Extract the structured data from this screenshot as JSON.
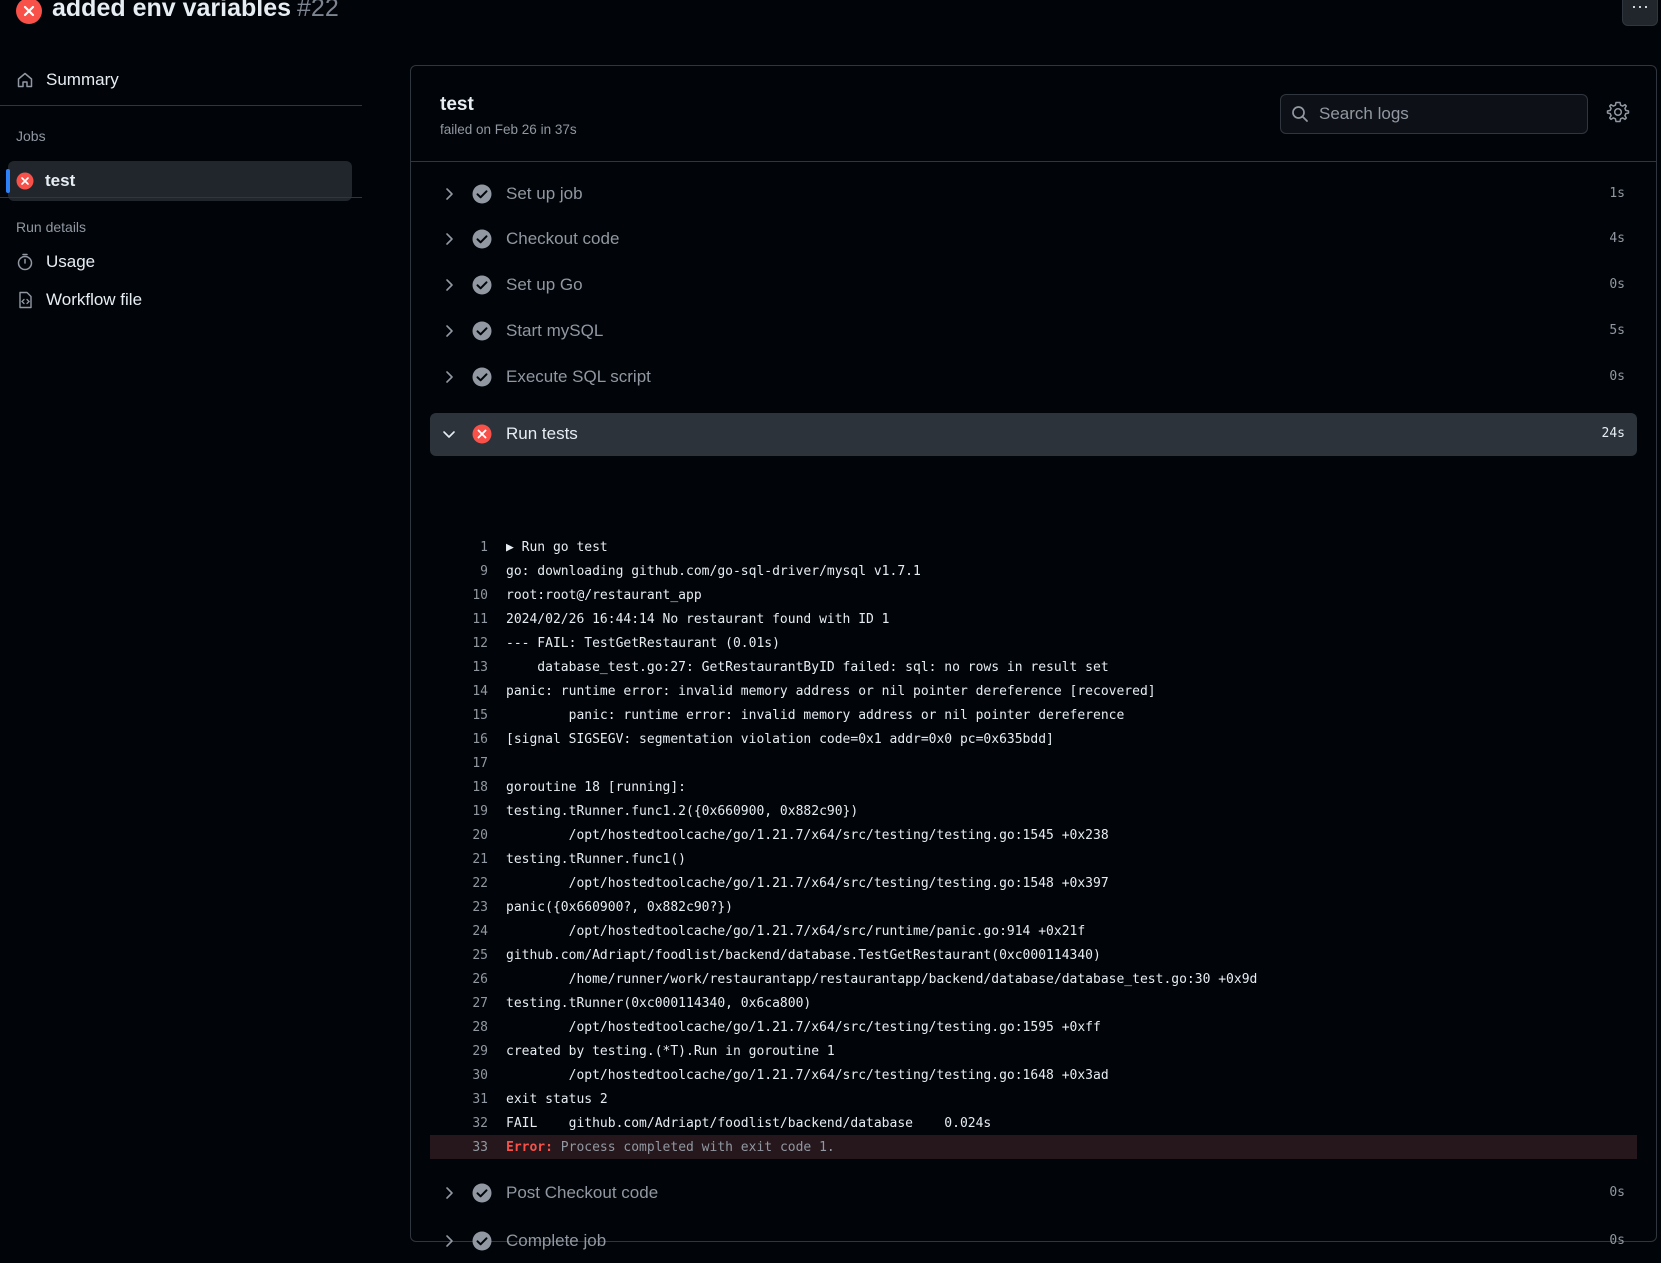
{
  "header": {
    "title": "added env variables",
    "run_number": "#22",
    "more_label": "···"
  },
  "sidebar": {
    "summary_label": "Summary",
    "jobs_heading": "Jobs",
    "job_label": "test",
    "run_details_heading": "Run details",
    "usage_label": "Usage",
    "workflow_file_label": "Workflow file"
  },
  "job": {
    "title": "test",
    "subtitle": "failed on Feb 26 in 37s",
    "search_placeholder": "Search logs"
  },
  "steps": [
    {
      "label": "Set up job",
      "duration": "1s",
      "status": "success"
    },
    {
      "label": "Checkout code",
      "duration": "4s",
      "status": "success"
    },
    {
      "label": "Set up Go",
      "duration": "0s",
      "status": "success"
    },
    {
      "label": "Start mySQL",
      "duration": "5s",
      "status": "success"
    },
    {
      "label": "Execute SQL script",
      "duration": "0s",
      "status": "success"
    },
    {
      "label": "Run tests",
      "duration": "24s",
      "status": "failure"
    },
    {
      "label": "Post Checkout code",
      "duration": "0s",
      "status": "success"
    },
    {
      "label": "Complete job",
      "duration": "0s",
      "status": "success"
    }
  ],
  "logs": [
    {
      "n": "1",
      "text": "▶ Run go test"
    },
    {
      "n": "9",
      "text": "go: downloading github.com/go-sql-driver/mysql v1.7.1"
    },
    {
      "n": "10",
      "text": "root:root@/restaurant_app"
    },
    {
      "n": "11",
      "text": "2024/02/26 16:44:14 No restaurant found with ID 1"
    },
    {
      "n": "12",
      "text": "--- FAIL: TestGetRestaurant (0.01s)"
    },
    {
      "n": "13",
      "text": "    database_test.go:27: GetRestaurantByID failed: sql: no rows in result set"
    },
    {
      "n": "14",
      "text": "panic: runtime error: invalid memory address or nil pointer dereference [recovered]"
    },
    {
      "n": "15",
      "text": "        panic: runtime error: invalid memory address or nil pointer dereference"
    },
    {
      "n": "16",
      "text": "[signal SIGSEGV: segmentation violation code=0x1 addr=0x0 pc=0x635bdd]"
    },
    {
      "n": "17",
      "text": ""
    },
    {
      "n": "18",
      "text": "goroutine 18 [running]:"
    },
    {
      "n": "19",
      "text": "testing.tRunner.func1.2({0x660900, 0x882c90})"
    },
    {
      "n": "20",
      "text": "        /opt/hostedtoolcache/go/1.21.7/x64/src/testing/testing.go:1545 +0x238"
    },
    {
      "n": "21",
      "text": "testing.tRunner.func1()"
    },
    {
      "n": "22",
      "text": "        /opt/hostedtoolcache/go/1.21.7/x64/src/testing/testing.go:1548 +0x397"
    },
    {
      "n": "23",
      "text": "panic({0x660900?, 0x882c90?})"
    },
    {
      "n": "24",
      "text": "        /opt/hostedtoolcache/go/1.21.7/x64/src/runtime/panic.go:914 +0x21f"
    },
    {
      "n": "25",
      "text": "github.com/Adriapt/foodlist/backend/database.TestGetRestaurant(0xc000114340)"
    },
    {
      "n": "26",
      "text": "        /home/runner/work/restaurantapp/restaurantapp/backend/database/database_test.go:30 +0x9d"
    },
    {
      "n": "27",
      "text": "testing.tRunner(0xc000114340, 0x6ca800)"
    },
    {
      "n": "28",
      "text": "        /opt/hostedtoolcache/go/1.21.7/x64/src/testing/testing.go:1595 +0xff"
    },
    {
      "n": "29",
      "text": "created by testing.(*T).Run in goroutine 1"
    },
    {
      "n": "30",
      "text": "        /opt/hostedtoolcache/go/1.21.7/x64/src/testing/testing.go:1648 +0x3ad"
    },
    {
      "n": "31",
      "text": "exit status 2"
    },
    {
      "n": "32",
      "text": "FAIL    github.com/Adriapt/foodlist/backend/database    0.024s"
    }
  ],
  "error_line": {
    "n": "33",
    "label": "Error:",
    "text": " Process completed with exit code 1."
  },
  "colors": {
    "background": "#010409",
    "border": "#30363d",
    "failure": "#f85149",
    "success_icon": "#9198a1",
    "active_bar": "#2f81f7"
  }
}
